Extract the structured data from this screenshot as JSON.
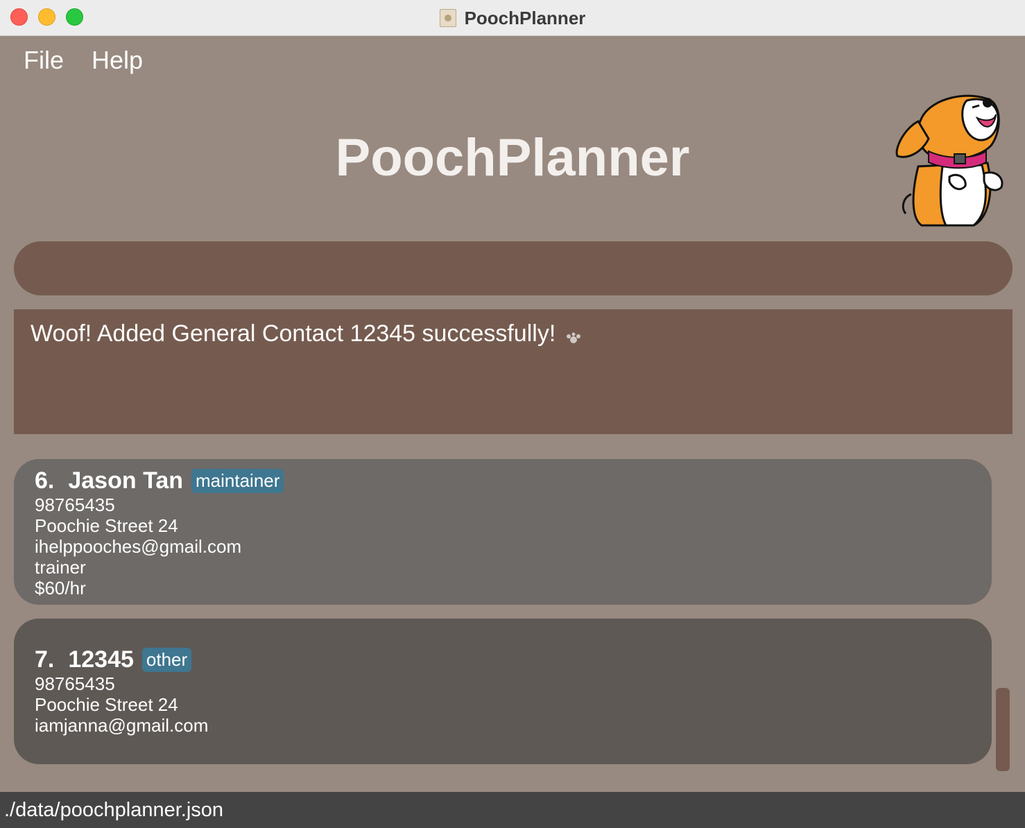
{
  "window": {
    "title": "PoochPlanner"
  },
  "menu": {
    "file": "File",
    "help": "Help"
  },
  "app": {
    "title": "PoochPlanner"
  },
  "command": {
    "value": ""
  },
  "result": {
    "message": "Woof! Added General Contact 12345 successfully!"
  },
  "contacts": [
    {
      "index": "6.",
      "name": "Jason Tan",
      "tag": "maintainer",
      "phone": "98765435",
      "address": "Poochie Street 24",
      "email": "ihelppooches@gmail.com",
      "skill": "trainer",
      "salary": "$60/hr"
    },
    {
      "index": "7.",
      "name": "12345",
      "tag": "other",
      "phone": "98765435",
      "address": "Poochie Street 24",
      "email": "iamjanna@gmail.com"
    }
  ],
  "status": {
    "path": "./data/poochplanner.json"
  },
  "colors": {
    "background": "#988a80",
    "panel": "#755b4f",
    "card_1": "#6e6a67",
    "card_2": "#5f5955",
    "tag": "#3f7690",
    "status_bar": "#444444"
  },
  "icons": {
    "mascot": "dog-mascot-icon",
    "paw": "paw-icon",
    "window_app": "app-icon"
  }
}
